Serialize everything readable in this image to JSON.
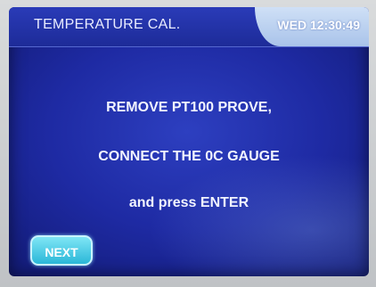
{
  "header": {
    "title": "TEMPERATURE CAL.",
    "datetime": "WED 12:30:49"
  },
  "message": {
    "line1": "REMOVE PT100 PROVE,",
    "line2": "CONNECT THE 0C GAUGE",
    "line3": "and press ENTER"
  },
  "actions": {
    "next_label": "NEXT"
  },
  "colors": {
    "screen_blue": "#1e2aa3",
    "button_cyan": "#2ab7d8",
    "clock_tab": "#bcd2f0"
  }
}
